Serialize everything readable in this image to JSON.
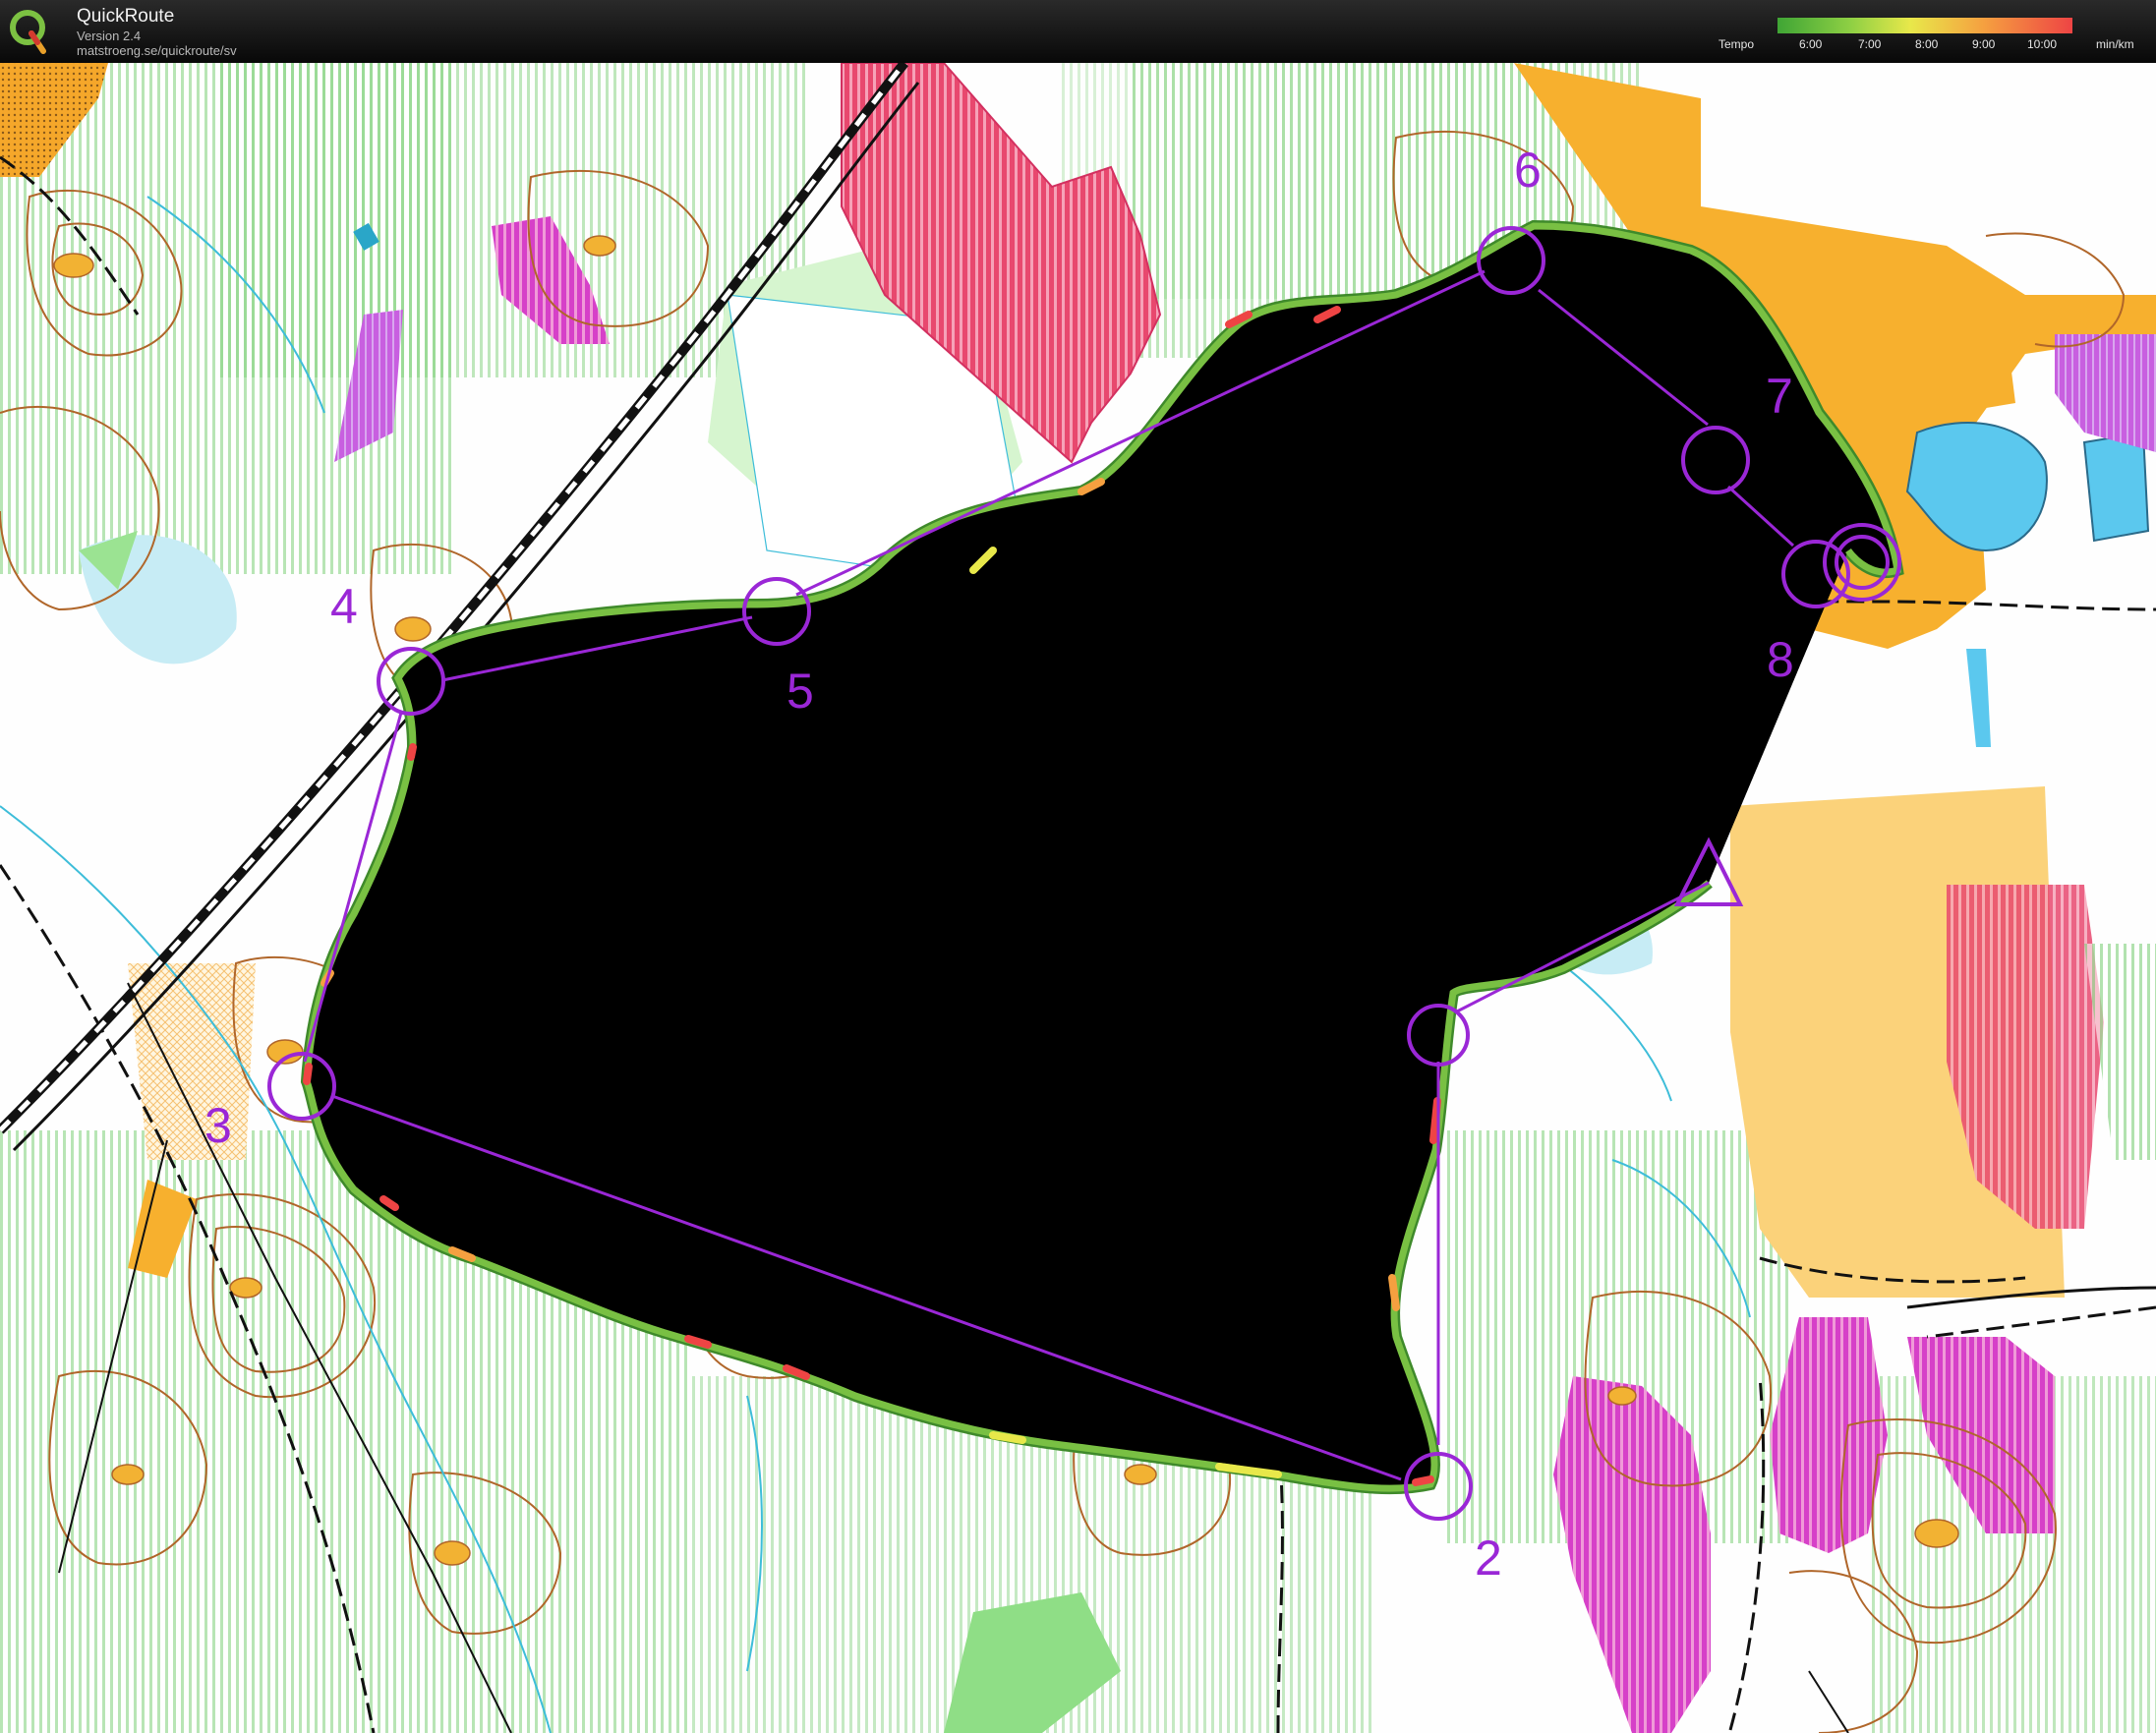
{
  "header": {
    "app_name": "QuickRoute",
    "version": "Version 2.4",
    "url": "matstroeng.se/quickroute/sv"
  },
  "legend": {
    "label": "Tempo",
    "ticks": [
      "6:00",
      "7:00",
      "8:00",
      "9:00",
      "10:00"
    ],
    "unit": "min/km",
    "colors": [
      "#3fa535",
      "#8fd044",
      "#e8e84a",
      "#f5a040",
      "#ee4444"
    ]
  },
  "map": {
    "course_color": "#9a27d6",
    "route_color": "#4f9a30",
    "icons": [
      "start-triangle",
      "control-circle",
      "finish-double-circle"
    ],
    "controls": [
      {
        "label": "2"
      },
      {
        "label": "3"
      },
      {
        "label": "4"
      },
      {
        "label": "5"
      },
      {
        "label": "6"
      },
      {
        "label": "7"
      },
      {
        "label": "8"
      }
    ]
  }
}
